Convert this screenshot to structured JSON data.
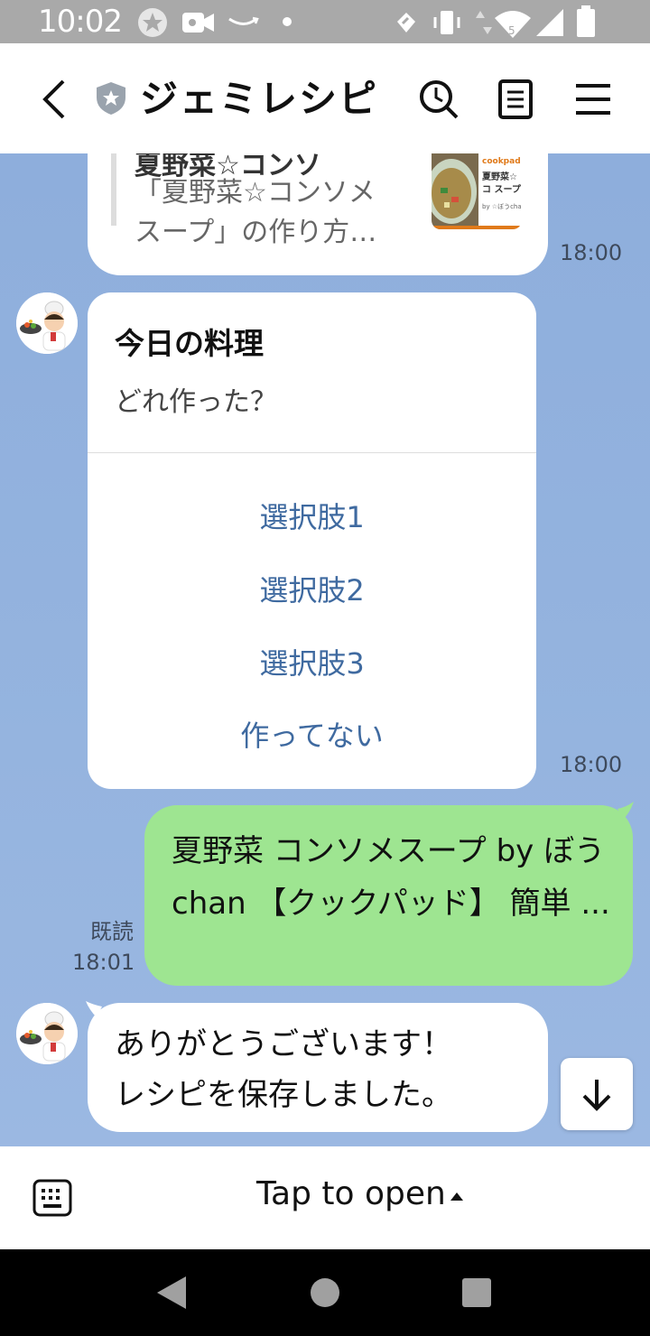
{
  "status_bar": {
    "time": "10:02"
  },
  "header": {
    "title": "ジェミレシピ"
  },
  "messages": {
    "link_preview": {
      "title": "夏野菜☆コンソ",
      "description": "「夏野菜☆コンソメスープ」の作り方…",
      "thumb_brand": "cookpad",
      "thumb_title": "夏野菜☆コ スープ",
      "thumb_byline": "by ☆ぼうchan",
      "time": "18:00"
    },
    "card": {
      "title": "今日の料理",
      "subtitle": "どれ作った？",
      "options": [
        "選択肢1",
        "選択肢2",
        "選択肢3",
        "作ってない"
      ],
      "time": "18:00"
    },
    "user_message": {
      "text": "夏野菜 コンソメスープ by ぼうchan 【クックパッド】 簡単 ...",
      "read_label": "既読",
      "time": "18:01"
    },
    "reply": {
      "line1": "ありがとうございます！",
      "line2": "レシピを保存しました。"
    }
  },
  "bottom_bar": {
    "tap_to_open": "Tap to open"
  },
  "colors": {
    "chat_bg": "#8eaedc",
    "user_bubble": "#9ee591",
    "option_text": "#3f6aa0"
  }
}
